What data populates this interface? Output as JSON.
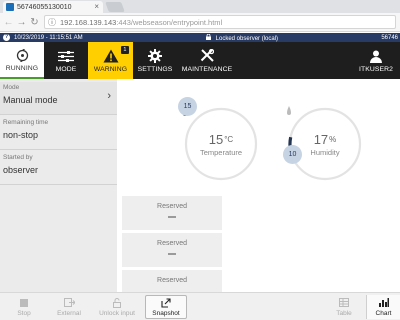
{
  "browser": {
    "tab_title": "56746055130010",
    "url_host": "192.168.139.143",
    "url_path": ":443/webseason/entrypoint.html"
  },
  "status": {
    "datetime": "10/23/2019 - 11:15:51 AM",
    "locked": "Locked observer (local)",
    "right_number": "56746"
  },
  "nav": {
    "running": "RUNNING",
    "mode": "MODE",
    "warning": "WARNING",
    "warning_count": "1",
    "settings": "SETTINGS",
    "maintenance": "MAINTENANCE",
    "user": "ITKUSER2"
  },
  "sidebar": {
    "mode_label": "Mode",
    "mode_value": "Manual mode",
    "remaining_label": "Remaining time",
    "remaining_value": "non-stop",
    "started_label": "Started by",
    "started_value": "observer"
  },
  "gauges": {
    "temperature": {
      "value": "15",
      "unit": "°C",
      "label": "Temperature",
      "setpoint": "15",
      "progress": 0.33
    },
    "humidity": {
      "value": "17",
      "unit": "%",
      "label": "Humidity",
      "setpoint": "10",
      "progress": 0.12
    }
  },
  "reserved": [
    "Reserved",
    "Reserved",
    "Reserved"
  ],
  "toolbar": {
    "stop": "Stop",
    "external": "External",
    "unlock": "Unlock input",
    "snapshot": "Snapshot",
    "table": "Table",
    "chart": "Chart"
  },
  "colors": {
    "status_bar": "#283b64",
    "nav_bg": "#1e1e1e",
    "warning": "#ffcf00",
    "gauge_arc": "#243551",
    "gauge_track": "#e3e3e3",
    "running_underline": "#4a9c2b"
  }
}
